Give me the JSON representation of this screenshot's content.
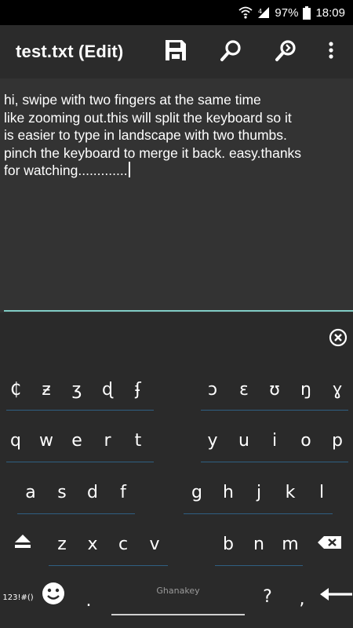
{
  "status": {
    "battery": "97%",
    "time": "18:09"
  },
  "appbar": {
    "title": "test.txt (Edit)"
  },
  "editor": {
    "text": "hi, swipe with two fingers at the same time\nlike zooming out.this will split the keyboard so it\nis easier to type in landscape with two thumbs.\npinch the keyboard to merge it back. easy.thanks\nfor watching............."
  },
  "keyboard": {
    "row_special": [
      "₵",
      "ƶ",
      "ʒ",
      "ɖ",
      "ʄ",
      "ɔ",
      "ɛ",
      "ʊ",
      "ŋ",
      "ɣ"
    ],
    "row1": [
      "q",
      "w",
      "e",
      "r",
      "t",
      "y",
      "u",
      "i",
      "o",
      "p"
    ],
    "row2": [
      "a",
      "s",
      "d",
      "f",
      "g",
      "h",
      "j",
      "k",
      "l"
    ],
    "row3": [
      "z",
      "x",
      "c",
      "v",
      "b",
      "n",
      "m"
    ],
    "symbols_label": "123!#()",
    "period": ".",
    "question": "?",
    "comma": ",",
    "space_label": "Ghanakey"
  }
}
